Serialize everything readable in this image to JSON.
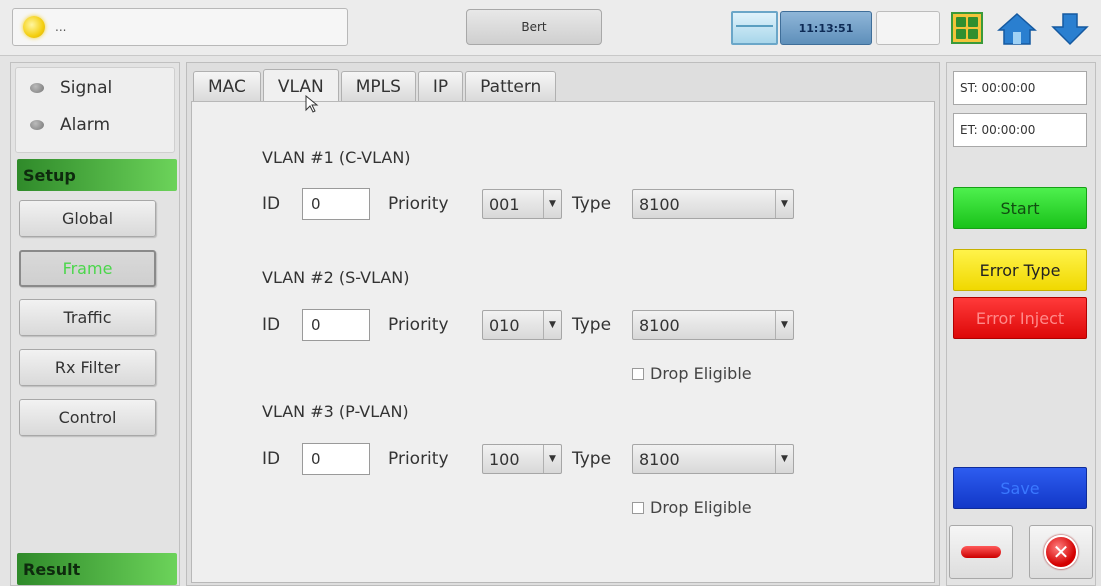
{
  "topbar": {
    "status_text": "...",
    "mode_label": "Bert",
    "clock": "11:13:51"
  },
  "left": {
    "indicators": [
      {
        "label": "Signal"
      },
      {
        "label": "Alarm"
      }
    ],
    "setup_header": "Setup",
    "nav_items": [
      {
        "label": "Global",
        "active": false
      },
      {
        "label": "Frame",
        "active": true
      },
      {
        "label": "Traffic",
        "active": false
      },
      {
        "label": "Rx Filter",
        "active": false
      },
      {
        "label": "Control",
        "active": false
      }
    ],
    "result_header": "Result"
  },
  "tabs": [
    {
      "label": "MAC",
      "active": false
    },
    {
      "label": "VLAN",
      "active": true
    },
    {
      "label": "MPLS",
      "active": false
    },
    {
      "label": "IP",
      "active": false
    },
    {
      "label": "Pattern",
      "active": false
    }
  ],
  "vlan": {
    "id_label": "ID",
    "priority_label": "Priority",
    "type_label": "Type",
    "drop_eligible_label": "Drop Eligible",
    "entries": [
      {
        "title": "VLAN #1 (C-VLAN)",
        "id": "0",
        "priority": "001",
        "type": "8100",
        "drop_eligible": null
      },
      {
        "title": "VLAN #2 (S-VLAN)",
        "id": "0",
        "priority": "010",
        "type": "8100",
        "drop_eligible": false
      },
      {
        "title": "VLAN #3 (P-VLAN)",
        "id": "0",
        "priority": "100",
        "type": "8100",
        "drop_eligible": false
      }
    ]
  },
  "right": {
    "start_time": "ST: 00:00:00",
    "end_time": "ET: 00:00:00",
    "start_label": "Start",
    "error_type_label": "Error Type",
    "error_inject_label": "Error Inject",
    "save_label": "Save"
  },
  "colors": {
    "start": "#19c219",
    "error_type": "#f0d800",
    "error_inject": "#dd0808",
    "save": "#1238c8",
    "setup_header": "#2f8a2a"
  }
}
